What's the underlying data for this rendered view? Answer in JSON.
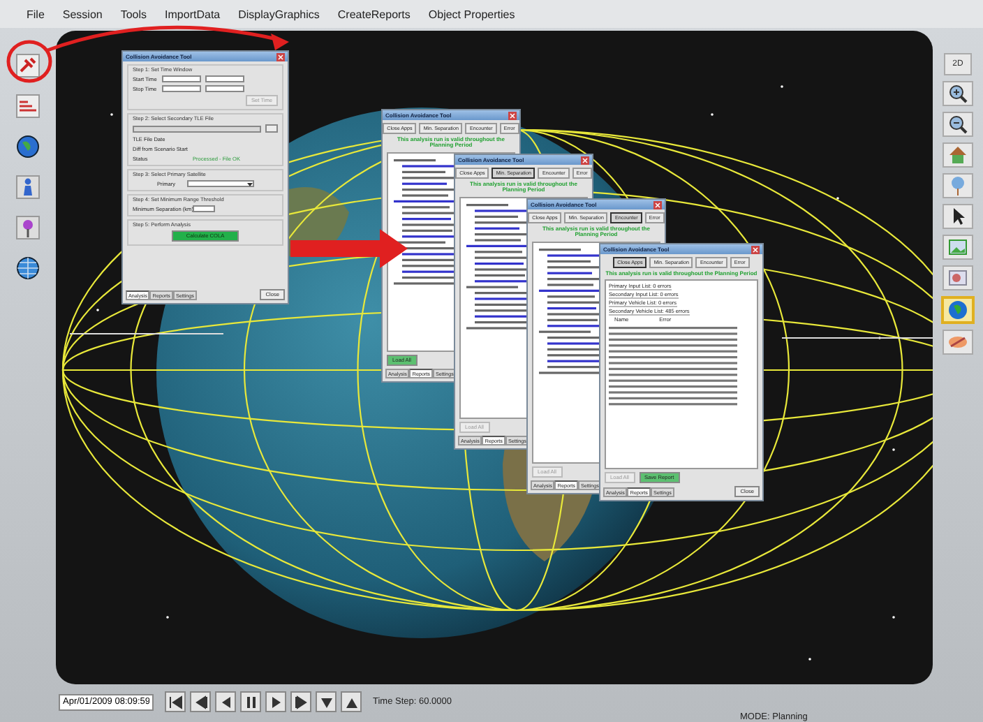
{
  "menu": [
    {
      "label": "File"
    },
    {
      "label": "Session"
    },
    {
      "label": "Tools"
    },
    {
      "label": "ImportData"
    },
    {
      "label": "DisplayGraphics"
    },
    {
      "label": "CreateReports"
    },
    {
      "label": "Object Properties"
    }
  ],
  "right_toolbar": {
    "label": "2D",
    "tools": [
      {
        "selected": false
      },
      {
        "selected": false
      },
      {
        "selected": false
      },
      {
        "selected": false
      },
      {
        "selected": false
      },
      {
        "selected": false
      },
      {
        "selected": false
      },
      {
        "selected": true
      },
      {
        "selected": false
      }
    ]
  },
  "dialogs": [
    {
      "kind": "setup",
      "title": "Collision Avoidance Tool",
      "steps": [
        {
          "heading": "Step 1: Set Time Window",
          "rows": [
            {
              "kind": "datetime",
              "label": "Start Time"
            },
            {
              "kind": "datetime",
              "label": "Stop Time"
            },
            {
              "kind": "button",
              "label": "Set Time",
              "disabled": true
            }
          ]
        },
        {
          "heading": "Step 2: Select Secondary TLE File",
          "rows": [
            {
              "kind": "file"
            },
            {
              "kind": "info",
              "label": "TLE File Date"
            },
            {
              "kind": "info",
              "label": "Diff from Scenario Start"
            },
            {
              "kind": "info",
              "label": "Status",
              "value": "Processed - File OK"
            }
          ]
        },
        {
          "heading": "Step 3: Select Primary Satellite",
          "rows": [
            {
              "kind": "dropdown",
              "label": "Primary"
            }
          ]
        },
        {
          "heading": "Step 4: Set Minimum Range Threshold",
          "rows": [
            {
              "kind": "number",
              "label": "Minimum Separation (km)"
            }
          ]
        },
        {
          "heading": "Step 5: Perform Analysis",
          "rows": [
            {
              "kind": "action",
              "label": "Calculate COLA"
            }
          ]
        }
      ],
      "tabs": [
        {
          "label": "Analysis",
          "selected": true
        },
        {
          "label": "Reports",
          "selected": false
        },
        {
          "label": "Settings",
          "selected": false
        }
      ],
      "close": "Close"
    },
    {
      "kind": "results",
      "title": "Collision Avoidance Tool",
      "buttons": [
        {
          "label": "Close Apps",
          "selected": false
        },
        {
          "label": "Min. Separation",
          "selected": false
        },
        {
          "label": "Encounter",
          "selected": false
        },
        {
          "label": "Error",
          "selected": false
        }
      ],
      "notice": "This analysis run is valid throughout the Planning Period",
      "footer": [
        {
          "label": "Load All",
          "disabled": false
        }
      ],
      "tabs": [
        {
          "label": "Analysis",
          "selected": false
        },
        {
          "label": "Reports",
          "selected": true
        },
        {
          "label": "Settings",
          "selected": false
        }
      ]
    },
    {
      "kind": "results",
      "title": "Collision Avoidance Tool",
      "buttons": [
        {
          "label": "Close Apps",
          "selected": false
        },
        {
          "label": "Min. Separation",
          "selected": true
        },
        {
          "label": "Encounter",
          "selected": false
        },
        {
          "label": "Error",
          "selected": false
        }
      ],
      "notice": "This analysis run is valid throughout the Planning Period",
      "footer": [
        {
          "label": "Load All",
          "disabled": true
        }
      ],
      "tabs": [
        {
          "label": "Analysis",
          "selected": false
        },
        {
          "label": "Reports",
          "selected": true
        },
        {
          "label": "Settings",
          "selected": false
        }
      ]
    },
    {
      "kind": "results",
      "title": "Collision Avoidance Tool",
      "buttons": [
        {
          "label": "Close Apps",
          "selected": false
        },
        {
          "label": "Min. Separation",
          "selected": false
        },
        {
          "label": "Encounter",
          "selected": true
        },
        {
          "label": "Error",
          "selected": false
        }
      ],
      "notice": "This analysis run is valid throughout the Planning Period",
      "footer": [
        {
          "label": "Load All",
          "disabled": true
        }
      ],
      "tabs": [
        {
          "label": "Analysis",
          "selected": false
        },
        {
          "label": "Reports",
          "selected": true
        },
        {
          "label": "Settings",
          "selected": false
        }
      ]
    },
    {
      "kind": "results",
      "title": "Collision Avoidance Tool",
      "buttons": [
        {
          "label": "Close Apps",
          "selected": true
        },
        {
          "label": "Min. Separation",
          "selected": false
        },
        {
          "label": "Encounter",
          "selected": false
        },
        {
          "label": "Error",
          "selected": false
        }
      ],
      "notice": "This analysis run is valid throughout the Planning Period",
      "lines": [
        "Primary Input List: 0 errors",
        "Secondary Input List: 0 errors",
        "Primary Vehicle List: 0 errors",
        "Secondary Vehicle List: 485 errors"
      ],
      "columns": [
        "Name",
        "Error"
      ],
      "footer": [
        {
          "label": "Load All",
          "disabled": true
        },
        {
          "label": "Save Report",
          "disabled": false
        }
      ],
      "tabs": [
        {
          "label": "Analysis",
          "selected": false
        },
        {
          "label": "Reports",
          "selected": true
        },
        {
          "label": "Settings",
          "selected": false
        }
      ],
      "close": "Close"
    }
  ],
  "playback": {
    "time": "Apr/01/2009 08:09:59",
    "time_step": "Time Step: 60.0000"
  },
  "status": {
    "mode": "MODE: Planning"
  }
}
